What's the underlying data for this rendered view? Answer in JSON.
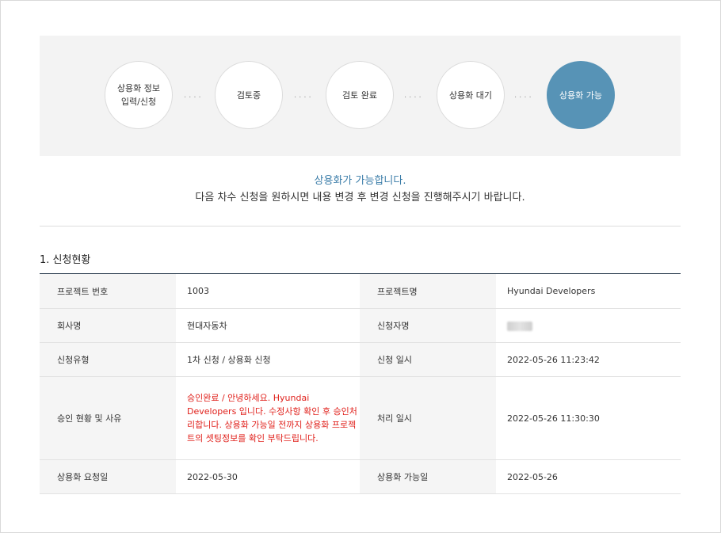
{
  "steps": [
    {
      "label": "상용화 정보\n입력/신청",
      "active": false
    },
    {
      "label": "검토중",
      "active": false
    },
    {
      "label": "검토 완료",
      "active": false
    },
    {
      "label": "상용화 대기",
      "active": false
    },
    {
      "label": "상용화 가능",
      "active": true
    }
  ],
  "step_separator": "····",
  "message": {
    "title": "상용화가 가능합니다.",
    "subtitle": "다음 차수 신청을 원하시면 내용 변경 후 변경 신청을 진행해주시기 바랍니다."
  },
  "section_title": "1. 신청현황",
  "table": {
    "rows": [
      {
        "l1": "프로젝트 번호",
        "v1": "1003",
        "l2": "프로젝트명",
        "v2": "Hyundai Developers"
      },
      {
        "l1": "회사명",
        "v1": "현대자동차",
        "l2": "신청자명",
        "v2": ""
      },
      {
        "l1": "신청유형",
        "v1": "1차 신청 / 상용화 신청",
        "l2": "신청 일시",
        "v2": "2022-05-26 11:23:42"
      },
      {
        "l1": "승인 현황 및 사유",
        "v1": "승인완료 / 안녕하세요. Hyundai Developers 입니다. 수정사항 확인 후 승인처리합니다. 상용화 가능일 전까지 상용화 프로젝트의 셋팅정보를 확인 부탁드립니다.",
        "l2": "처리 일시",
        "v2": "2022-05-26 11:30:30"
      },
      {
        "l1": "상용화 요청일",
        "v1": "2022-05-30",
        "l2": "상용화 가능일",
        "v2": "2022-05-26"
      }
    ]
  },
  "colors": {
    "accent": "#5793b6",
    "title_blue": "#3a7ca8",
    "reason_red": "#e0201b",
    "label_bg": "#f5f5f5"
  }
}
